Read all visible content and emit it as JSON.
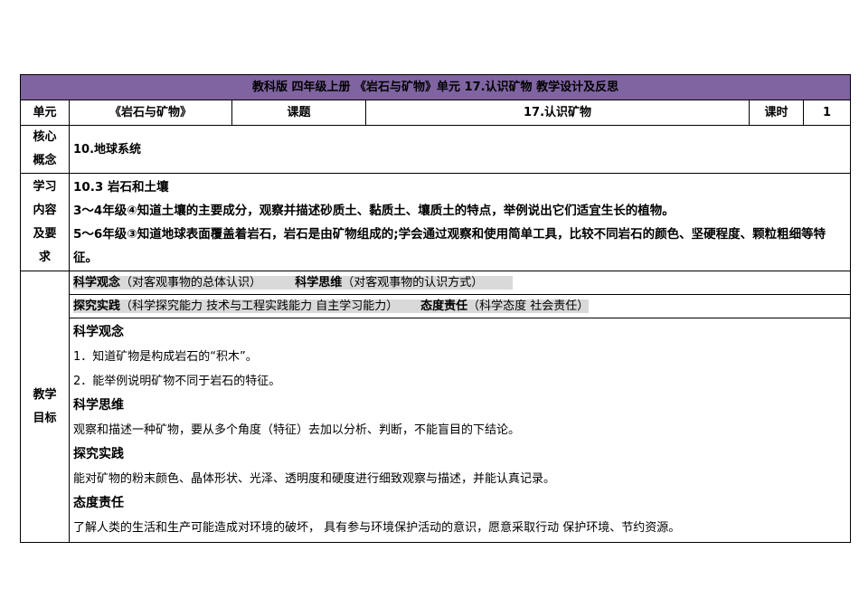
{
  "header": {
    "title": "教科版  四年级上册  《岩石与矿物》单元    17.认识矿物     教学设计及反思"
  },
  "unit_row": {
    "unit_label": "单元",
    "unit_value": "《岩石与矿物》",
    "topic_label": "课题",
    "topic_value": "17.认识矿物",
    "period_label": "课时",
    "period_value": "1"
  },
  "core": {
    "label": "核心概念",
    "value": "10.地球系统"
  },
  "requirements": {
    "label": "学习内容及要求",
    "lines": [
      "10.3  岩石和土壤",
      "3～4年级④知道土壤的主要成分，观察并描述砂质土、黏质土、壤质土的特点，举例说出它们适宜生长的植物。",
      "5～6年级③知道地球表面覆盖着岩石，岩石是由矿物组成的;学会通过观察和使用简单工具，比较不同岩石的颜色、坚硬程度、颗粒粗细等特征。"
    ]
  },
  "objectives": {
    "label": "教学目标",
    "literacy_line1": {
      "a_title": "科学观念",
      "a_desc": "（对客观事物的总体认识）",
      "b_title": "科学思维",
      "b_desc": "（对客观事物的认识方式）"
    },
    "literacy_line2": {
      "a_title": "探究实践",
      "a_desc": "（科学探究能力  技术与工程实践能力  自主学习能力）",
      "b_title": "态度责任",
      "b_desc": "（科学态度  社会责任）"
    },
    "sections": [
      {
        "heading": "科学观念",
        "items": [
          "1．知道矿物是构成岩石的“积木”。",
          "2．能举例说明矿物不同于岩石的特征。"
        ]
      },
      {
        "heading": "科学思维",
        "items": [
          "观察和描述一种矿物，要从多个角度（特征）去加以分析、判断，不能盲目的下结论。"
        ]
      },
      {
        "heading": "探究实践",
        "items": [
          "能对矿物的粉末颜色、晶体形状、光泽、透明度和硬度进行细致观察与描述，并能认真记录。"
        ]
      },
      {
        "heading": "态度责任",
        "items": [
          "了解人类的生活和生产可能造成对环境的破坏，  具有参与环境保护活动的意识，愿意采取行动  保护环境、节约资源。"
        ]
      }
    ]
  }
}
